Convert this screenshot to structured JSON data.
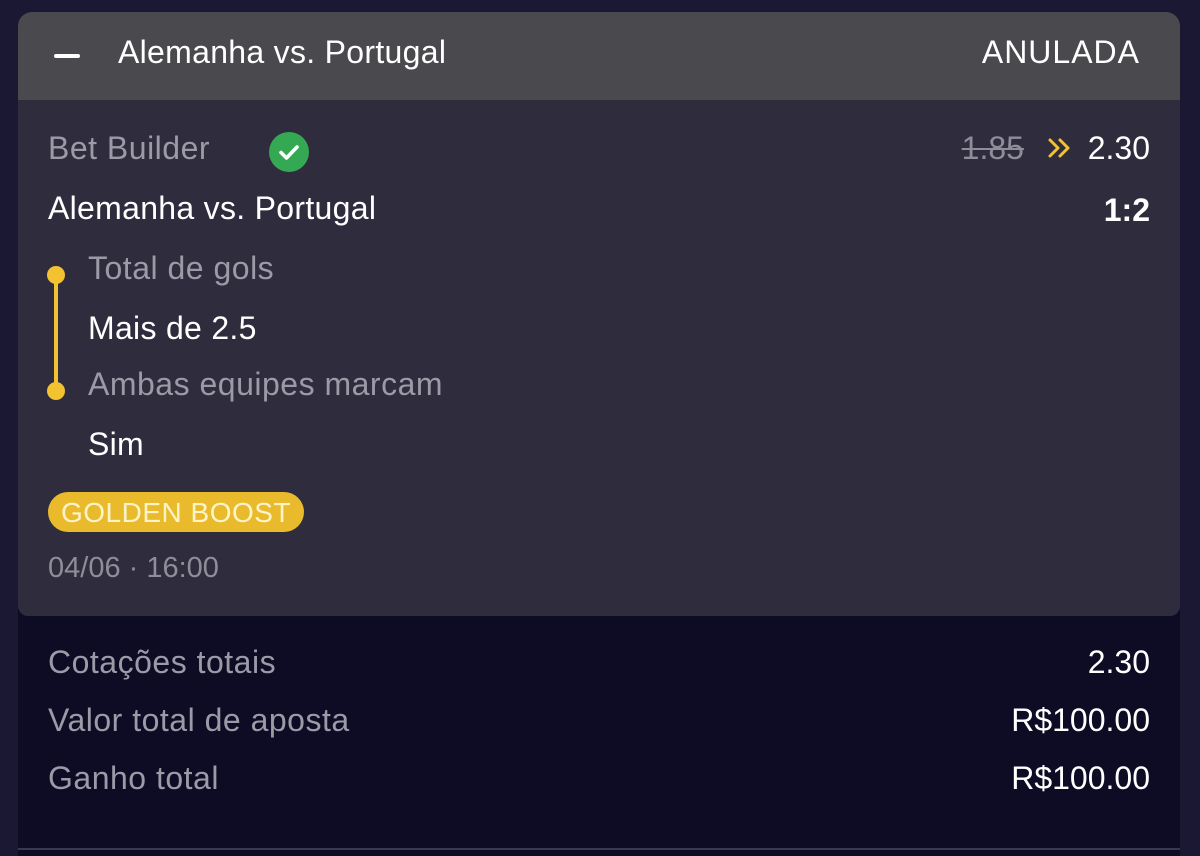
{
  "header": {
    "match": "Alemanha vs. Portugal",
    "status": "ANULADA"
  },
  "selection": {
    "bet_type": "Bet Builder",
    "odds_old": "1.85",
    "odds_new": "2.30",
    "match": "Alemanha vs. Portugal",
    "score": "1:2",
    "legs": [
      {
        "market": "Total de gols",
        "pick": "Mais de 2.5"
      },
      {
        "market": "Ambas equipes marcam",
        "pick": "Sim"
      }
    ],
    "badge": "GOLDEN BOOST",
    "datetime": "04/06 · 16:00"
  },
  "summary": {
    "total_odds_label": "Cotações totais",
    "total_odds_value": "2.30",
    "stake_label": "Valor total de aposta",
    "stake_value": "R$100.00",
    "winnings_label": "Ganho total",
    "winnings_value": "R$100.00"
  },
  "icons": {
    "collapse": "minus-icon",
    "status": "check-circle-icon",
    "boost_arrow": "double-chevron-right-icon"
  },
  "colors": {
    "accent": "#f2c231",
    "success": "#34a853",
    "header_bg": "#4a4a4e",
    "card_bg": "#2f2d3d",
    "page_bg": "#0e0b24"
  }
}
